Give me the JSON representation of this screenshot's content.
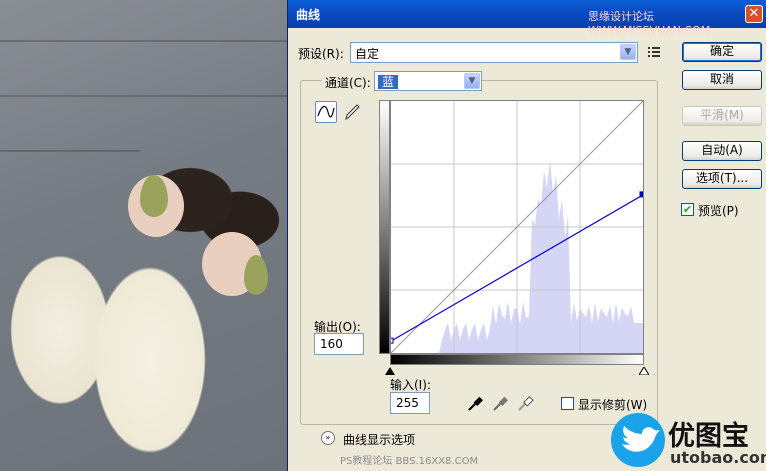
{
  "window": {
    "title": "曲线",
    "watermark_top": "思缘设计论坛 WWW.MISSVUAN.COM",
    "close_glyph": "✕"
  },
  "preset": {
    "label": "预设(R):",
    "value": "自定"
  },
  "channel": {
    "label": "通道(C):",
    "value": "蓝"
  },
  "buttons": {
    "ok": "确定",
    "cancel": "取消",
    "smooth": "平滑(M)",
    "auto": "自动(A)",
    "options": "选项(T)..."
  },
  "preview": {
    "label": "预览(P)",
    "checked": true
  },
  "output": {
    "label": "输出(O):",
    "value": "160"
  },
  "input": {
    "label": "输入(I):",
    "value": "255"
  },
  "show_clipping": {
    "label": "显示修剪(W)",
    "checked": false
  },
  "curve_display_options": "曲线显示选项",
  "curve": {
    "channel_color": "#0000cc",
    "points": [
      [
        0,
        12
      ],
      [
        255,
        160
      ]
    ]
  },
  "brand": {
    "name": "优图宝",
    "domain": "utobao.com",
    "watermark_bottom": "PS教程论坛 BBS.16XX8.COM"
  },
  "colors": {
    "title_bar": "#0b4cc4",
    "dialog_bg": "#ece9d8",
    "histogram": "#d5d5f5",
    "brand_bird": "#1aa3e8"
  }
}
